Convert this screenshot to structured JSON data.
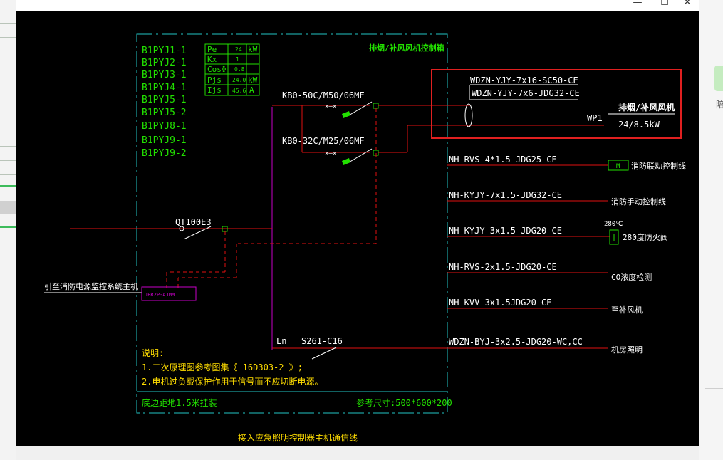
{
  "window": {
    "min_label": "—",
    "max_label": "☐",
    "close_label": "✕"
  },
  "side_panel": {
    "button_text": "陪"
  },
  "drawing": {
    "circuit_ids": [
      "B1PYJ1-1",
      "B1PYJ2-1",
      "B1PYJ3-1",
      "B1PYJ4-1",
      "B1PYJ5-1",
      "B1PYJ5-2",
      "B1PYJ8-1",
      "B1PYJ9-1",
      "B1PYJ9-2"
    ],
    "param_table": [
      {
        "name": "Pe",
        "value": "24",
        "unit": "kW"
      },
      {
        "name": "Kx",
        "value": "1",
        "unit": ""
      },
      {
        "name": "CosΦ",
        "value": "0.8",
        "unit": ""
      },
      {
        "name": "Pjs",
        "value": "24.0",
        "unit": "kW"
      },
      {
        "name": "Ijs",
        "value": "45.6",
        "unit": "A"
      }
    ],
    "panel_title": "排烟/补风风机控制箱",
    "breaker1": "KB0-50C/M50/06MF",
    "breaker2": "KB0-32C/M25/06MF",
    "main_switch": "QT100E3",
    "ln_label": "Ln",
    "breaker3": "S261-C16",
    "fire_monitor": "引至消防电源监控系统主机",
    "module_label": "JBR2P-AJMM",
    "cable1": "WDZN-YJY-7x16-SC50-CE",
    "cable2": "WDZN-YJY-7x6-JDG32-CE",
    "fan_label": "排烟/补风风机",
    "wp1": "WP1",
    "power": "24/8.5kW",
    "lines": [
      {
        "cable": "NH-RVS-4*1.5-JDG25-CE",
        "dest": "消防联动控制线"
      },
      {
        "cable": "NH-KYJY-7x1.5-JDG32-CE",
        "dest": "消防手动控制线"
      },
      {
        "cable": "NH-KYJY-3x1.5-JDG20-CE",
        "dest": "280度防火阀"
      },
      {
        "cable": "NH-RVS-2x1.5-JDG20-CE",
        "dest": "CO浓度检测"
      },
      {
        "cable": "NH-KVV-3x1.5JDG20-CE",
        "dest": "至补风机"
      },
      {
        "cable": "WDZN-BYJ-3x2.5-JDG20-WC,CC",
        "dest": "机房照明"
      }
    ],
    "m_box": "M",
    "temp_280": "280℃",
    "notes_title": "说明:",
    "note1": "1.二次原理图参考图集《    16D303-2 》;",
    "note2": "2.电机过负载保护作用于信号而不应切断电源。",
    "mount": "底边距地1.5米挂装",
    "size": "参考尺寸:500*600*200",
    "bottom_caption": "接入应急照明控制器主机通信线"
  }
}
